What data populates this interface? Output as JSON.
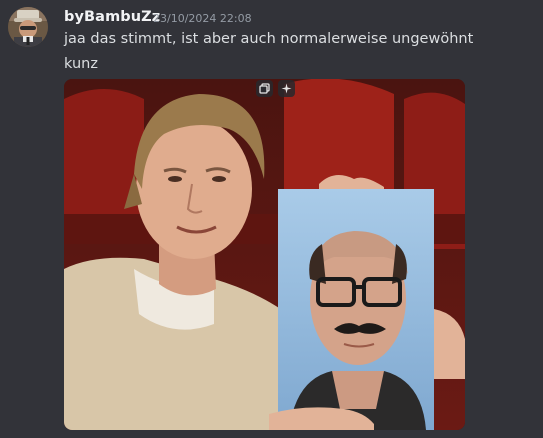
{
  "message": {
    "username": "byBambuZz",
    "timestamp": "23/10/2024 22:08",
    "lines": [
      "jaa das stimmt, ist aber auch normalerweise ungewöhnt",
      "kunz"
    ]
  },
  "attachment": {
    "type": "image",
    "actions": [
      "copy-icon",
      "sparkle-icon"
    ]
  },
  "colors": {
    "background": "#323339",
    "username": "#f2f3f5",
    "timestamp": "#949ba4",
    "text": "#dbdee1"
  }
}
